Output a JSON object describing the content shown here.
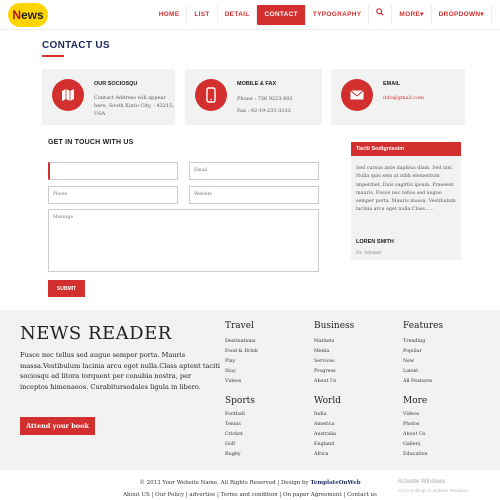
{
  "logo": {
    "n": "N",
    "rest": "ews"
  },
  "nav": [
    {
      "label": "HOME"
    },
    {
      "label": "LIST"
    },
    {
      "label": "DETAIL"
    },
    {
      "label": "CONTACT",
      "active": true
    },
    {
      "label": "TYPOGRAPHY"
    },
    {
      "label": "🔍"
    },
    {
      "label": "MORE▾"
    },
    {
      "label": "DROPDOWN▾"
    }
  ],
  "page_title": "CONTACT US",
  "cards": {
    "c1": {
      "title": "OUR SOCIOSQU",
      "text": "Contact Address will appear here, South Korio City, - 43215, USA",
      "icon": "map-icon"
    },
    "c2": {
      "title": "MOBILE & FAX",
      "line1": "Phone : 756 9223 602",
      "line2": "Fax : 92-19-233-3333",
      "icon": "mobile-icon"
    },
    "c3": {
      "title": "EMAIL",
      "text": "info@gmail.com",
      "icon": "envelope-icon"
    }
  },
  "form": {
    "title": "GET IN TOUCH WITH US",
    "name_placeholder": "",
    "email_placeholder": "Email",
    "phone_placeholder": "Phone",
    "website_placeholder": "Website",
    "message_placeholder": "Message",
    "submit_label": "SUBMIT"
  },
  "widget": {
    "heading": "Taciti Sodignissim",
    "text": "Sed cursus ante dapibus diam. Sed nisi. Nulla quis sem at nibh elementum imperdiet. Duis sagittis ipsum. Praesent mauris. Fusce nec tellus sed augue semper porta. Mauris massa. Vestibulum lacinia arcu eget nulla.Class......",
    "name": "LOREN SMITH",
    "role": "Dr. Adviser"
  },
  "footer": {
    "brand": "NEWS READER",
    "desc": "Fusce nec tellus sed augue semper porta. Mauris massa.Vestibulum lacinia arcu eget nulla.Class aptent taciti sociosqu ad litora torquent per conubia nostra, per inceptos himenaeos. Curabitursodales ligula in libero.",
    "button": "Attend your book",
    "travel": {
      "title": "Travel",
      "links": "Destinations\nFood & Drink\nPlay\nStay\nVideos"
    },
    "business": {
      "title": "Business",
      "links": "Markets\nMedia\nServices\nProgress\nAbout Us"
    },
    "features": {
      "title": "Features",
      "links": "Trending\nPopular\nNew\nLatest\nAll Features"
    },
    "sports": {
      "title": "Sports",
      "links": "Football\nTennis\nCricket\nGolf\nRugby"
    },
    "world": {
      "title": "World",
      "links": "India\nAmerica\nAustralia\nEngland\nAfrica"
    },
    "more": {
      "title": "More",
      "links": "Videos\nPhotos\nAbout Us\nGallery\nEducation"
    }
  },
  "copyright": {
    "text": "© 2013 Your Website Name. All Rights Reserved | Design by ",
    "link": "TemplateOnWeb"
  },
  "bottom_links": "About US  |  Our Policy  |  advertise  |  Terms and condition  |  On paper Agreement  |  Contact us",
  "watermark": {
    "title": "Activate Windows",
    "sub": "Go to Settings to activate Windows."
  }
}
